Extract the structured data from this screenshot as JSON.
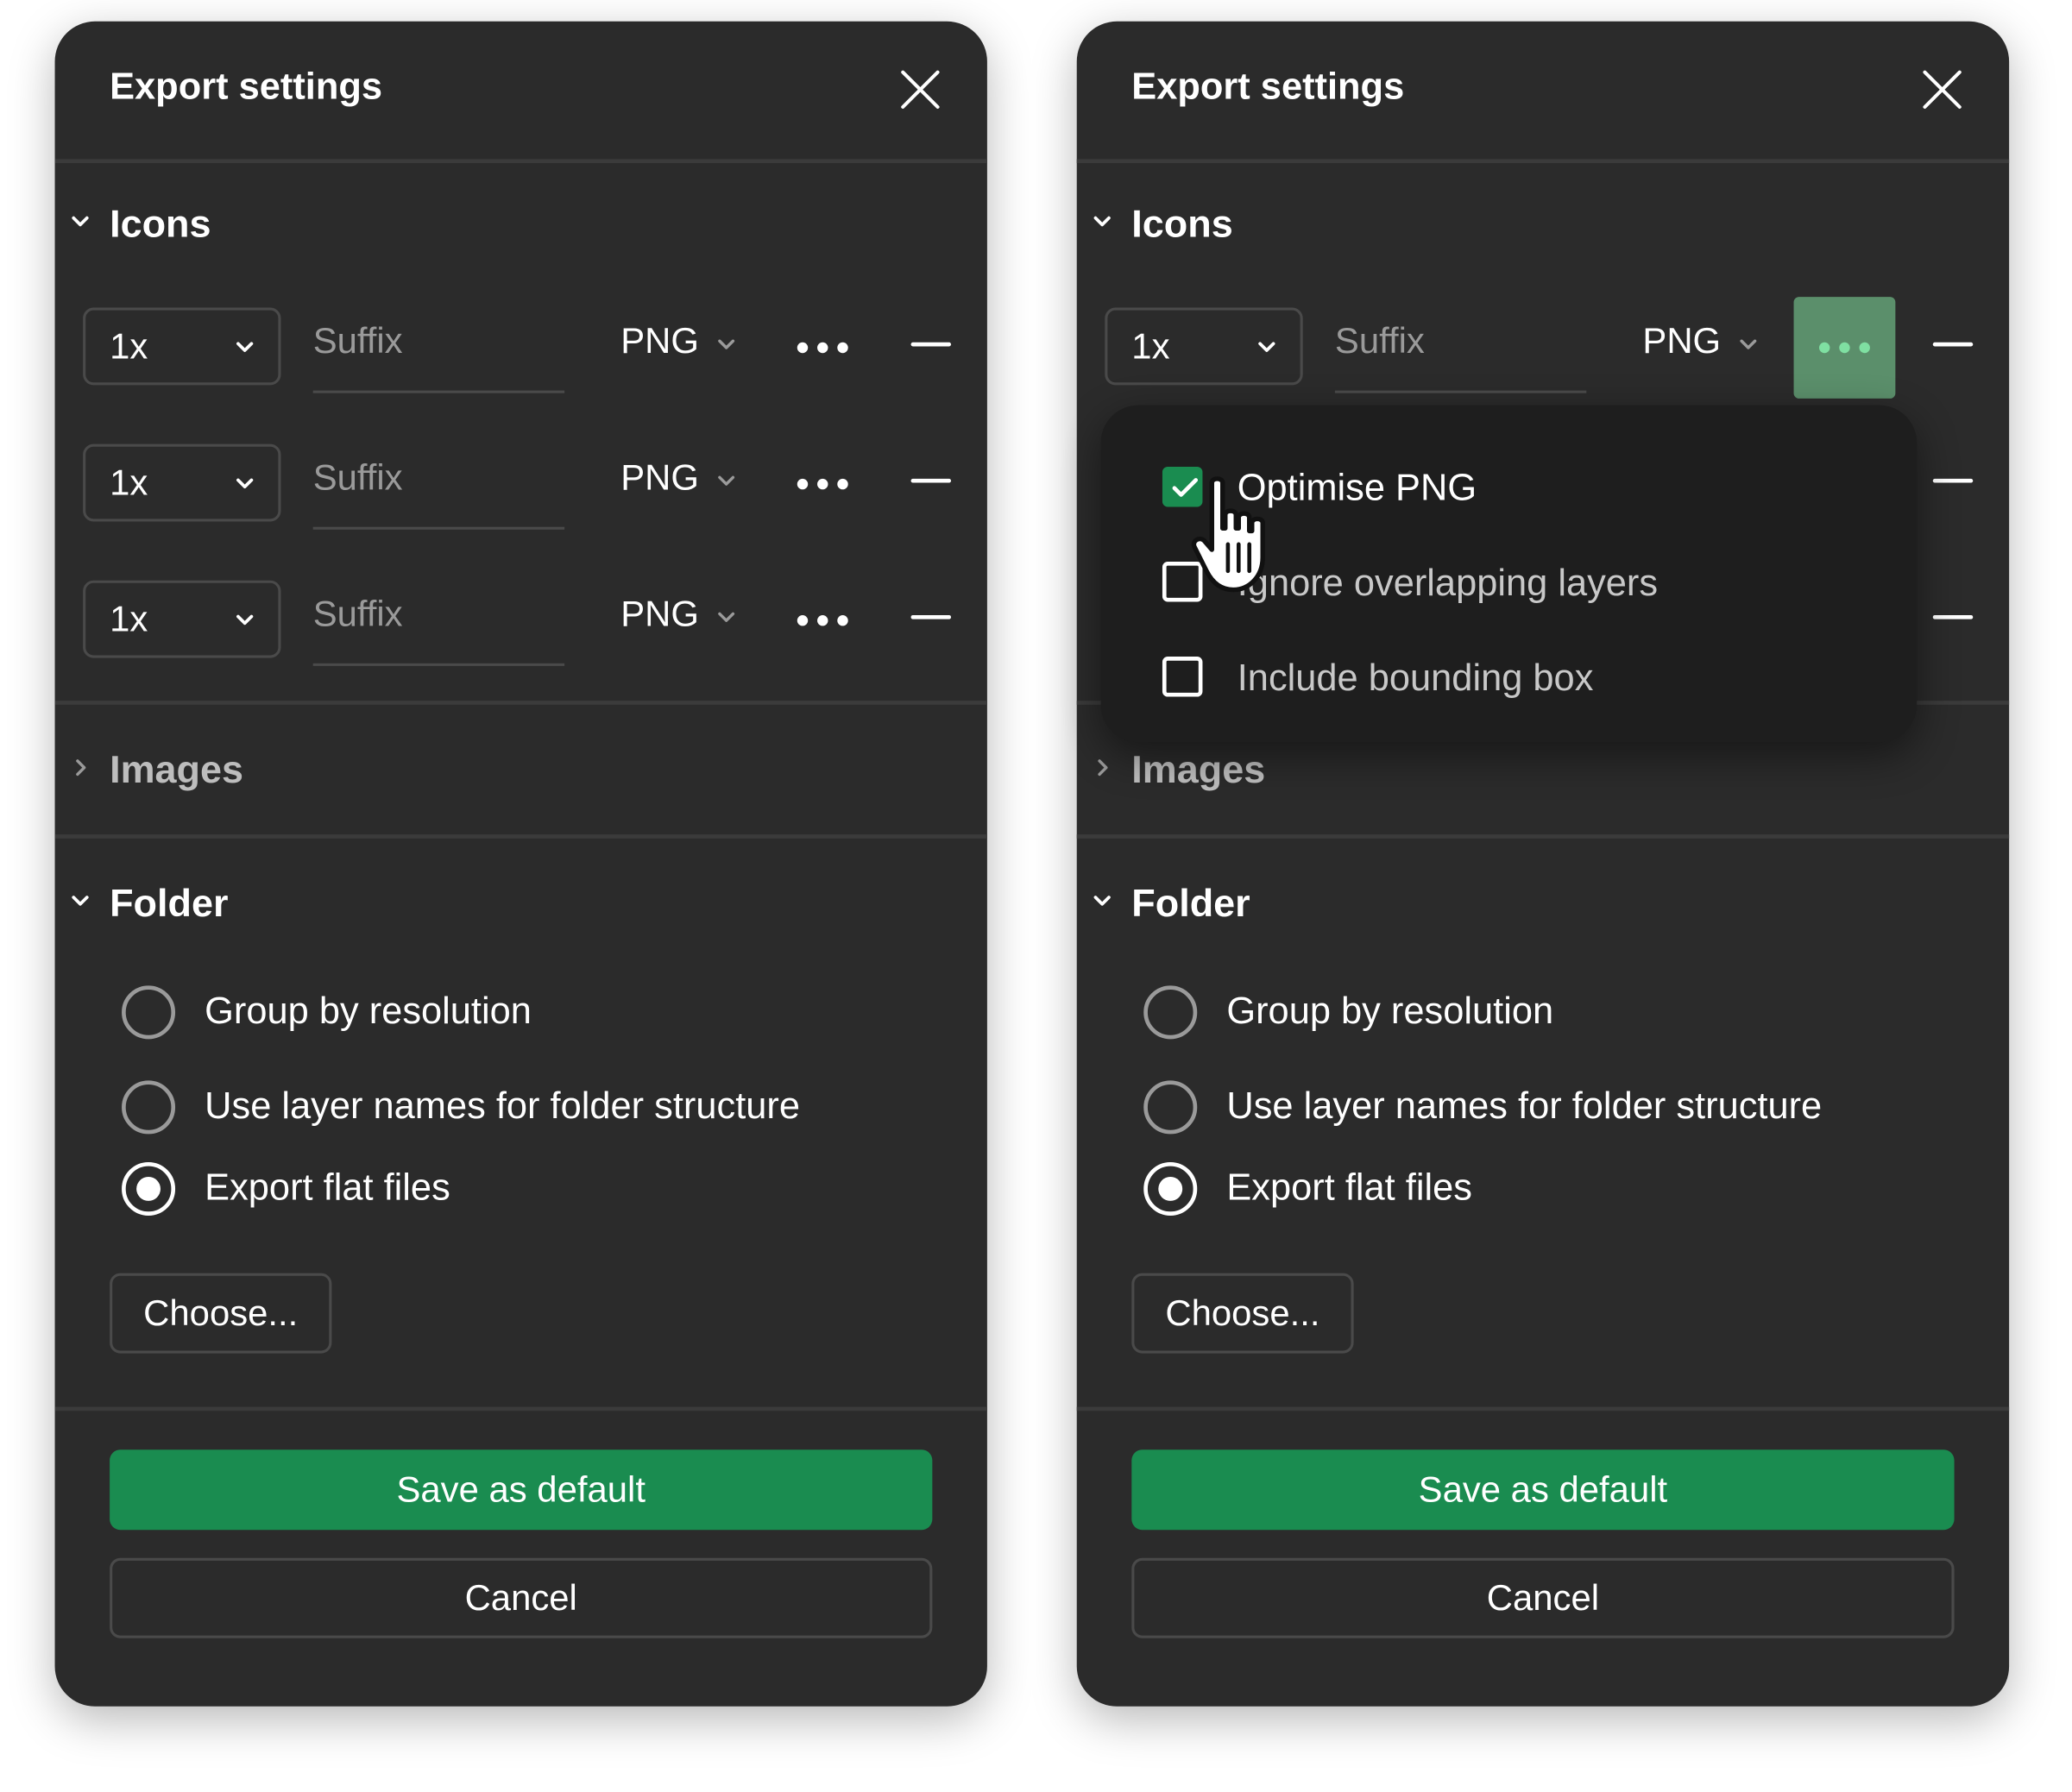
{
  "panels": [
    {
      "title": "Export settings",
      "icons_section": "Icons",
      "rows": [
        {
          "scale": "1x",
          "suffix_placeholder": "Suffix",
          "format": "PNG"
        },
        {
          "scale": "1x",
          "suffix_placeholder": "Suffix",
          "format": "PNG"
        },
        {
          "scale": "1x",
          "suffix_placeholder": "Suffix",
          "format": "PNG"
        }
      ],
      "images_section": "Images",
      "folder_section": "Folder",
      "folder_options": [
        {
          "label": "Group by resolution",
          "selected": false
        },
        {
          "label": "Use layer names for folder structure",
          "selected": false
        },
        {
          "label": "Export flat files",
          "selected": true
        }
      ],
      "choose_label": "Choose...",
      "save_label": "Save as default",
      "cancel_label": "Cancel"
    },
    {
      "title": "Export settings",
      "icons_section": "Icons",
      "rows": [
        {
          "scale": "1x",
          "suffix_placeholder": "Suffix",
          "format": "PNG"
        },
        {
          "scale": "1x",
          "suffix_placeholder": "Suffix",
          "format": "PNG"
        },
        {
          "scale": "1x",
          "suffix_placeholder": "Suffix",
          "format": "PNG"
        }
      ],
      "images_section": "Images",
      "folder_section": "Folder",
      "folder_options": [
        {
          "label": "Group by resolution",
          "selected": false
        },
        {
          "label": "Use layer names for folder structure",
          "selected": false
        },
        {
          "label": "Export flat files",
          "selected": true
        }
      ],
      "choose_label": "Choose...",
      "save_label": "Save as default",
      "cancel_label": "Cancel",
      "more_menu": {
        "options": [
          {
            "label": "Optimise PNG",
            "checked": true
          },
          {
            "label": "Ignore overlapping layers",
            "checked": false
          },
          {
            "label": "Include bounding box",
            "checked": false
          }
        ]
      }
    }
  ],
  "colors": {
    "panel_bg": "#2b2b2b",
    "accent_green": "#1a8c50",
    "more_active_bg": "#5b8f6b",
    "popover_bg": "#1e1e1e"
  },
  "icons": {
    "close": "close-icon",
    "chevron_down": "chevron-down-icon",
    "chevron_right": "chevron-right-icon",
    "more": "more-dots-icon",
    "minus": "minus-icon",
    "check": "check-icon",
    "cursor": "hand-pointer-cursor-icon"
  }
}
